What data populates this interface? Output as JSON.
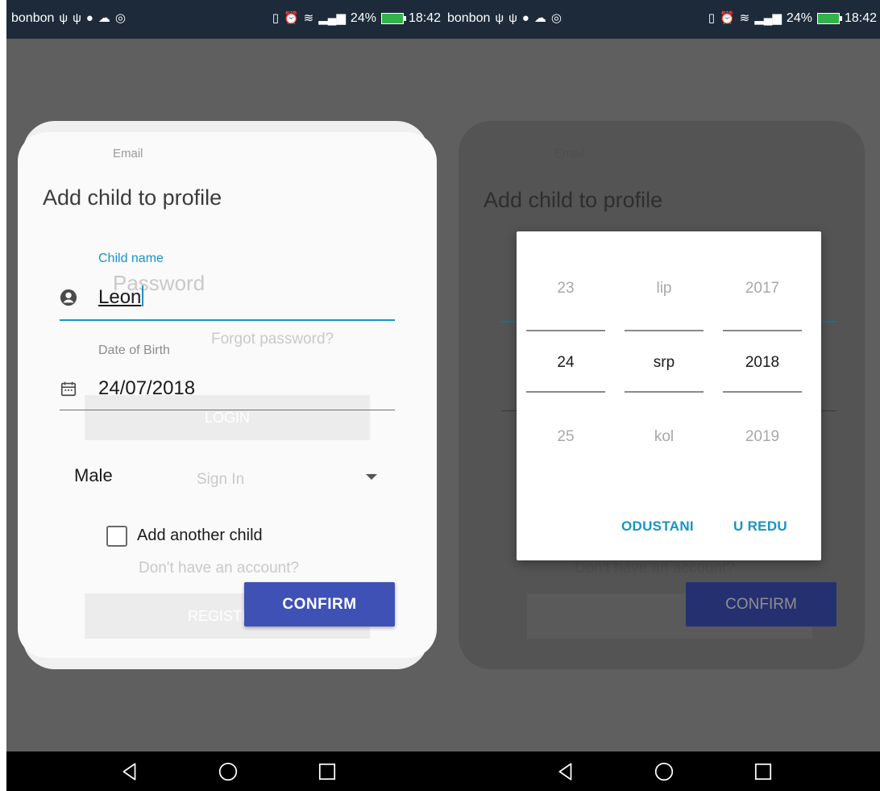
{
  "status_bar": {
    "carrier": "bonbon",
    "battery": "24%",
    "time": "18:42",
    "icons": [
      "usb-icon",
      "usb-icon",
      "messenger-icon",
      "cloud-icon",
      "instagram-icon",
      "vibrate-icon",
      "alarm-icon",
      "wifi-icon",
      "signal-icon",
      "battery-icon"
    ]
  },
  "background_form": {
    "email_label": "Email",
    "password_placeholder": "Password",
    "forgot_password": "Forgot password?",
    "login_button": "LOGIN",
    "sign_in": "Sign In",
    "no_account": "Don't have an account?",
    "register_button": "REGISTER"
  },
  "dialog": {
    "title": "Add child to profile",
    "child_name_label": "Child name",
    "child_name_value": "Leon",
    "dob_label": "Date of Birth",
    "dob_value": "24/07/2018",
    "gender_value": "Male",
    "add_another_label": "Add another child",
    "add_another_checked": false,
    "confirm_button": "CONFIRM"
  },
  "date_picker": {
    "days": [
      "23",
      "24",
      "25"
    ],
    "months": [
      "lip",
      "srp",
      "kol"
    ],
    "years": [
      "2017",
      "2018",
      "2019"
    ],
    "cancel_button": "ODUSTANI",
    "ok_button": "U REDU"
  },
  "colors": {
    "accent": "#1894c8",
    "primary_button": "#3f51b5",
    "status_bar": "#1d2a3a",
    "overlay": "#5f5f5f"
  }
}
